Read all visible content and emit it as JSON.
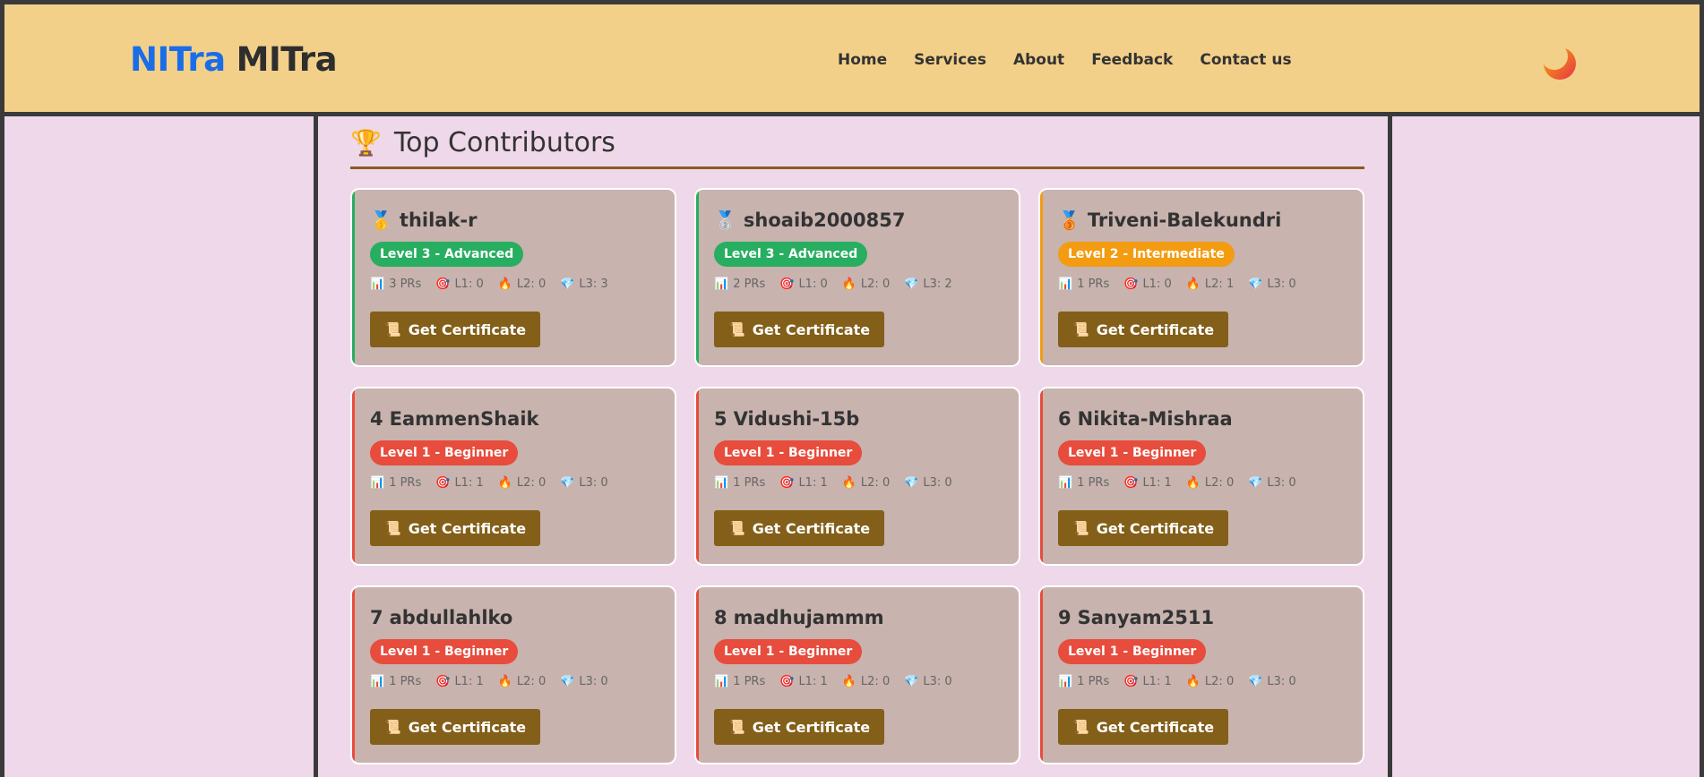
{
  "logo": {
    "part1": "NITra",
    "part2": "MITra"
  },
  "nav": [
    "Home",
    "Services",
    "About",
    "Feedback",
    "Contact us"
  ],
  "section": {
    "icon": "trophy-icon",
    "title": "Top Contributors"
  },
  "colors": {
    "level3": "#27ae60",
    "level2": "#f39c12",
    "level1": "#e74c3c",
    "button": "#835f19"
  },
  "contributors": [
    {
      "rank": "",
      "medal": "🥇",
      "name": "thilak-r",
      "level": "Level 3 - Advanced",
      "tier": 3,
      "prs": "3 PRs",
      "l1": "L1: 0",
      "l2": "L2: 0",
      "l3": "L3: 3",
      "button": "Get Certificate"
    },
    {
      "rank": "",
      "medal": "🥈",
      "name": "shoaib2000857",
      "level": "Level 3 - Advanced",
      "tier": 3,
      "prs": "2 PRs",
      "l1": "L1: 0",
      "l2": "L2: 0",
      "l3": "L3: 2",
      "button": "Get Certificate"
    },
    {
      "rank": "",
      "medal": "🥉",
      "name": "Triveni-Balekundri",
      "level": "Level 2 - Intermediate",
      "tier": 2,
      "prs": "1 PRs",
      "l1": "L1: 0",
      "l2": "L2: 1",
      "l3": "L3: 0",
      "button": "Get Certificate"
    },
    {
      "rank": "4",
      "medal": "",
      "name": "EammenShaik",
      "level": "Level 1 - Beginner",
      "tier": 1,
      "prs": "1 PRs",
      "l1": "L1: 1",
      "l2": "L2: 0",
      "l3": "L3: 0",
      "button": "Get Certificate"
    },
    {
      "rank": "5",
      "medal": "",
      "name": "Vidushi-15b",
      "level": "Level 1 - Beginner",
      "tier": 1,
      "prs": "1 PRs",
      "l1": "L1: 1",
      "l2": "L2: 0",
      "l3": "L3: 0",
      "button": "Get Certificate"
    },
    {
      "rank": "6",
      "medal": "",
      "name": "Nikita-Mishraa",
      "level": "Level 1 - Beginner",
      "tier": 1,
      "prs": "1 PRs",
      "l1": "L1: 1",
      "l2": "L2: 0",
      "l3": "L3: 0",
      "button": "Get Certificate"
    },
    {
      "rank": "7",
      "medal": "",
      "name": "abdullahlko",
      "level": "Level 1 - Beginner",
      "tier": 1,
      "prs": "1 PRs",
      "l1": "L1: 1",
      "l2": "L2: 0",
      "l3": "L3: 0",
      "button": "Get Certificate"
    },
    {
      "rank": "8",
      "medal": "",
      "name": "madhujammm",
      "level": "Level 1 - Beginner",
      "tier": 1,
      "prs": "1 PRs",
      "l1": "L1: 1",
      "l2": "L2: 0",
      "l3": "L3: 0",
      "button": "Get Certificate"
    },
    {
      "rank": "9",
      "medal": "",
      "name": "Sanyam2511",
      "level": "Level 1 - Beginner",
      "tier": 1,
      "prs": "1 PRs",
      "l1": "L1: 1",
      "l2": "L2: 0",
      "l3": "L3: 0",
      "button": "Get Certificate"
    }
  ]
}
